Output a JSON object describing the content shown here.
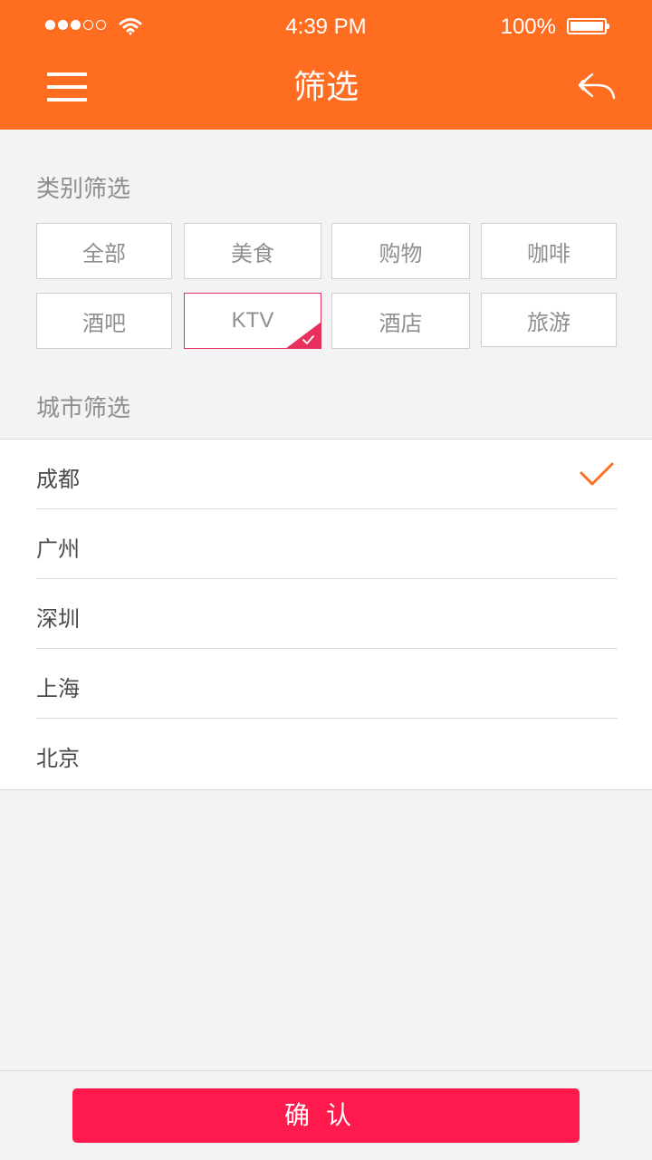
{
  "status_bar": {
    "time": "4:39 PM",
    "battery": "100%",
    "signal_icon": "signal-dots-icon",
    "wifi_icon": "wifi-icon",
    "battery_icon": "battery-icon"
  },
  "header": {
    "title": "筛选",
    "menu_icon": "hamburger-menu-icon",
    "back_icon": "reply-back-icon",
    "background": "#ff6d20"
  },
  "category_section": {
    "label": "类别筛选",
    "items": [
      {
        "label": "全部",
        "selected": false
      },
      {
        "label": "美食",
        "selected": false
      },
      {
        "label": "购物",
        "selected": false
      },
      {
        "label": "咖啡",
        "selected": false
      },
      {
        "label": "酒吧",
        "selected": false
      },
      {
        "label": "KTV",
        "selected": true
      },
      {
        "label": "酒店",
        "selected": false
      },
      {
        "label": "旅游",
        "selected": false
      }
    ],
    "selected_color": "#e8305c"
  },
  "city_section": {
    "label": "城市筛选",
    "items": [
      {
        "label": "成都",
        "selected": true
      },
      {
        "label": "广州",
        "selected": false
      },
      {
        "label": "深圳",
        "selected": false
      },
      {
        "label": "上海",
        "selected": false
      },
      {
        "label": "北京",
        "selected": false
      }
    ],
    "check_icon": "checkmark-icon",
    "check_color": "#ff6d20"
  },
  "footer": {
    "confirm_label": "确认",
    "button_color": "#ff1a4e"
  }
}
